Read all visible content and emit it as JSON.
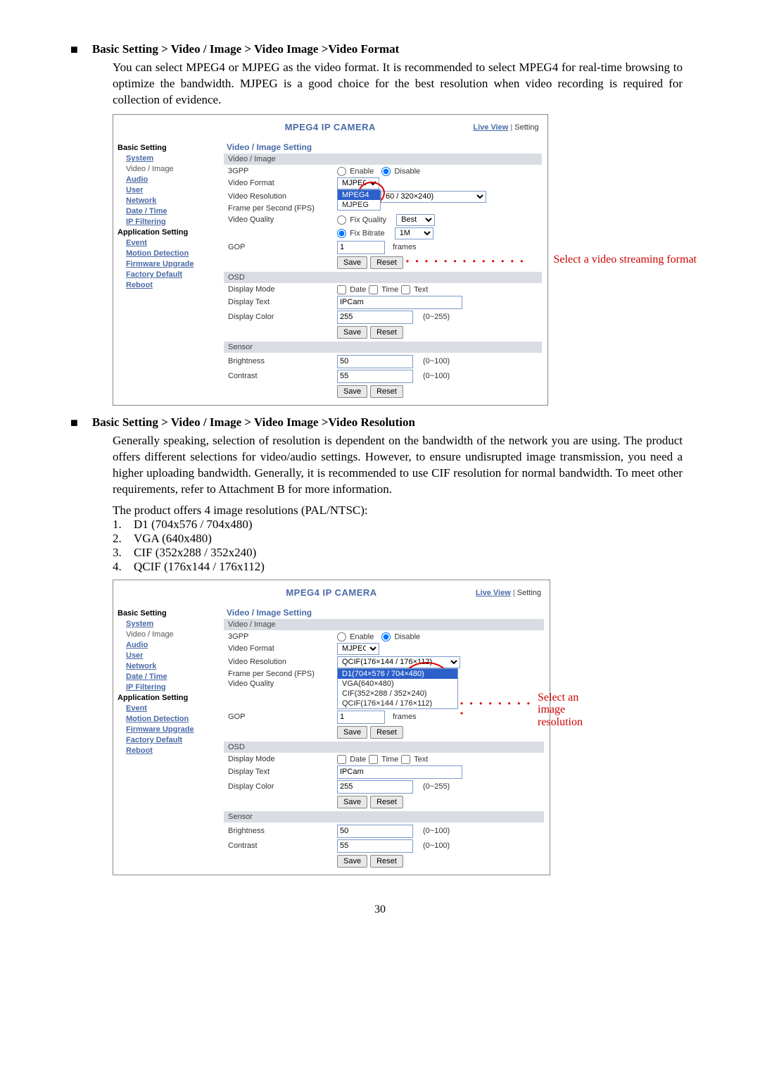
{
  "s1": {
    "heading": "Basic Setting > Video / Image > Video Image >Video Format",
    "body": "You can select MPEG4 or MJPEG as the video format. It is recommended to select MPEG4 for real-time browsing to optimize the bandwidth. MJPEG is a good choice for the best resolution when video recording is required for collection of evidence.",
    "annotation": "Select a video streaming format"
  },
  "s2": {
    "heading": "Basic Setting > Video / Image > Video Image >Video Resolution",
    "body": "Generally speaking, selection of resolution is dependent on the bandwidth of the network you are using. The product offers different selections for video/audio settings. However, to ensure undisrupted image transmission, you need a higher uploading bandwidth. Generally, it is recommended to use CIF resolution for normal bandwidth. To meet other requirements, refer to Attachment B for more information.",
    "intro": "The product offers 4 image resolutions (PAL/NTSC):",
    "resolutions": [
      "D1 (704x576 / 704x480)",
      "VGA (640x480)",
      "CIF (352x288 / 352x240)",
      "QCIF (176x144 / 176x112)"
    ],
    "annotation_line1": "Select an image",
    "annotation_line2": "resolution"
  },
  "panel": {
    "cam_title": "MPEG4 IP CAMERA",
    "live_view": "Live View",
    "setting": "Setting",
    "setting_title": "Video / Image Setting",
    "sidebar": {
      "group1": "Basic Setting",
      "items1": [
        "System",
        "Video / Image",
        "Audio",
        "User",
        "Network",
        "Date / Time",
        "IP Filtering"
      ],
      "group2": "Application Setting",
      "items2": [
        "Event",
        "Motion Detection",
        "Firmware Upgrade",
        "Factory Default",
        "Reboot"
      ]
    },
    "sections": {
      "video_image": "Video / Image",
      "osd": "OSD",
      "sensor": "Sensor"
    },
    "labels": {
      "gpp": "3GPP",
      "enable": "Enable",
      "disable": "Disable",
      "video_format": "Video Format",
      "video_resolution": "Video Resolution",
      "fps": "Frame per Second (FPS)",
      "video_quality": "Video Quality",
      "fix_quality": "Fix Quality",
      "fix_bitrate": "Fix Bitrate",
      "gop": "GOP",
      "frames": "frames",
      "display_mode": "Display Mode",
      "date": "Date",
      "time": "Time",
      "text": "Text",
      "display_text": "Display Text",
      "display_color": "Display Color",
      "brightness": "Brightness",
      "contrast": "Contrast",
      "save": "Save",
      "reset": "Reset"
    },
    "values1": {
      "format": "MJPEG",
      "format_opts": [
        "MPEG4",
        "MJPEG"
      ],
      "res_sel": "60 / 320×240)",
      "quality_sel": "Best",
      "bitrate_sel": "1M",
      "gop": "1",
      "display_text": "IPCam",
      "display_color": "255",
      "display_color_range": "(0~255)",
      "brightness": "50",
      "brightness_range": "(0~100)",
      "contrast": "55",
      "contrast_range": "(0~100)"
    },
    "values2": {
      "format": "MJPEG",
      "res_sel": "QCIF(176×144 / 176×112)",
      "res_opts": [
        "D1(704×576 / 704×480)",
        "VGA(640×480)",
        "CIF(352×288 / 352×240)",
        "QCIF(176×144 / 176×112)"
      ],
      "gop": "1",
      "display_text": "IPCam",
      "display_color": "255",
      "display_color_range": "(0~255)",
      "brightness": "50",
      "brightness_range": "(0~100)",
      "contrast": "55",
      "contrast_range": "(0~100)"
    }
  },
  "page_number": "30"
}
